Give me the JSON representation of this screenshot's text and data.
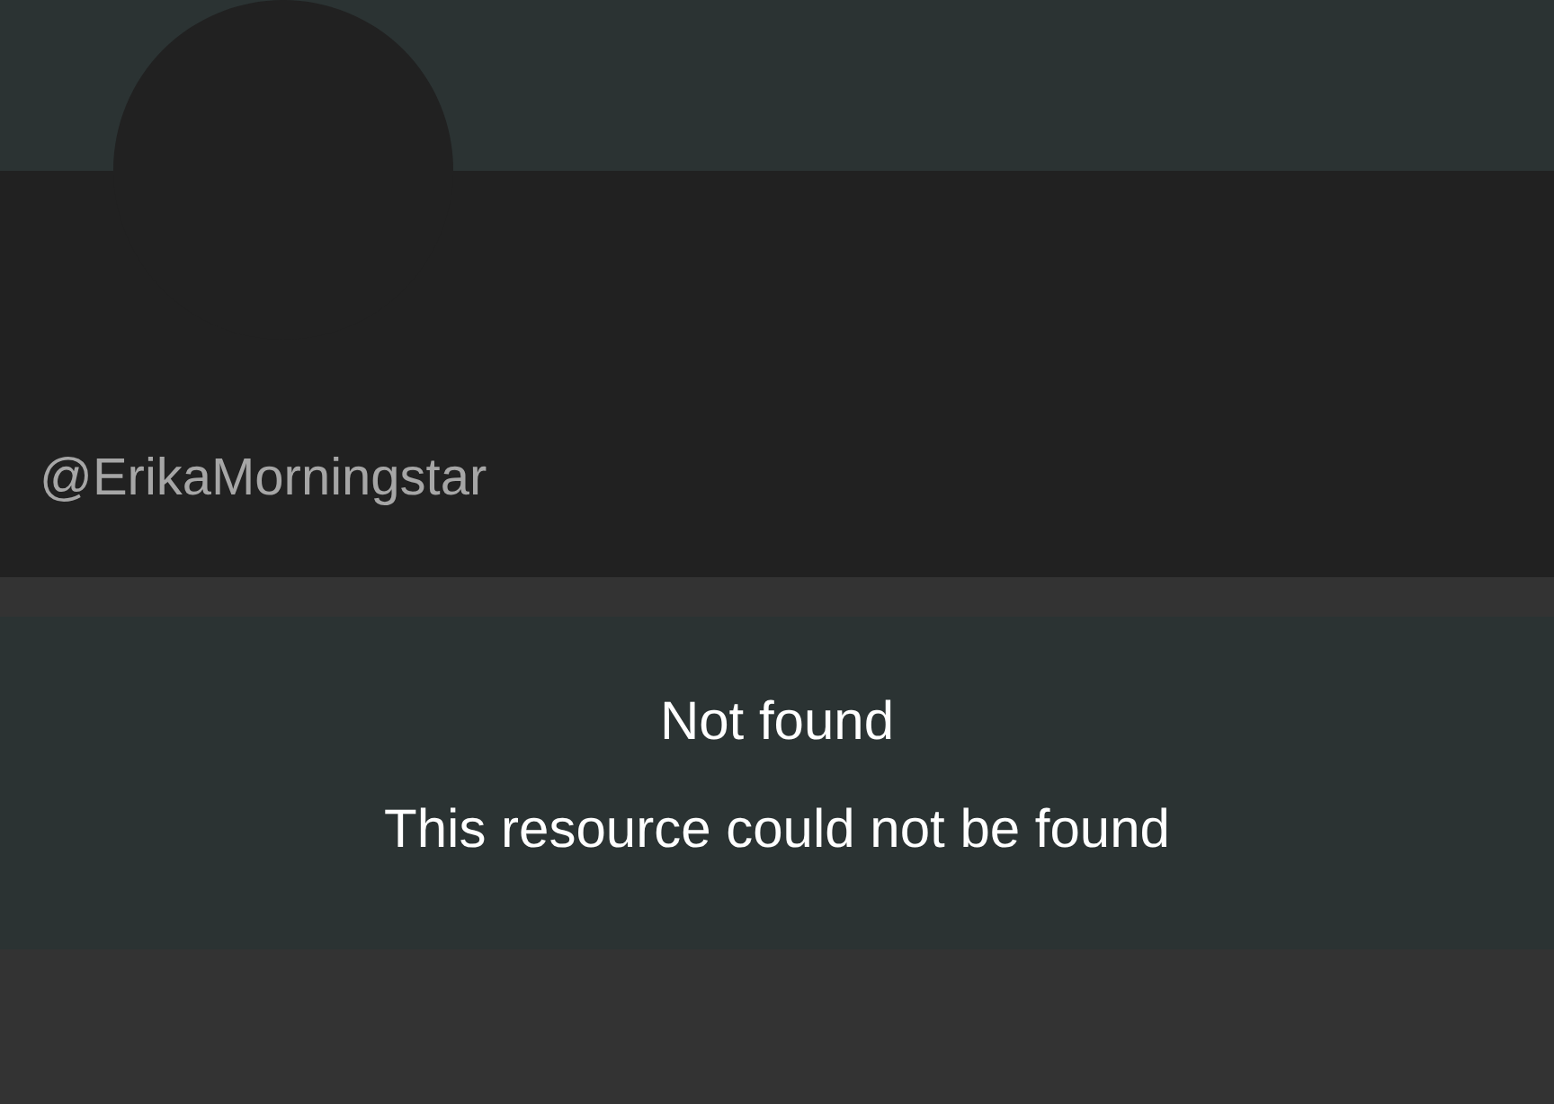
{
  "profile": {
    "handle": "@ErikaMorningstar"
  },
  "message": {
    "title": "Not found",
    "text": "This resource could not be found"
  }
}
